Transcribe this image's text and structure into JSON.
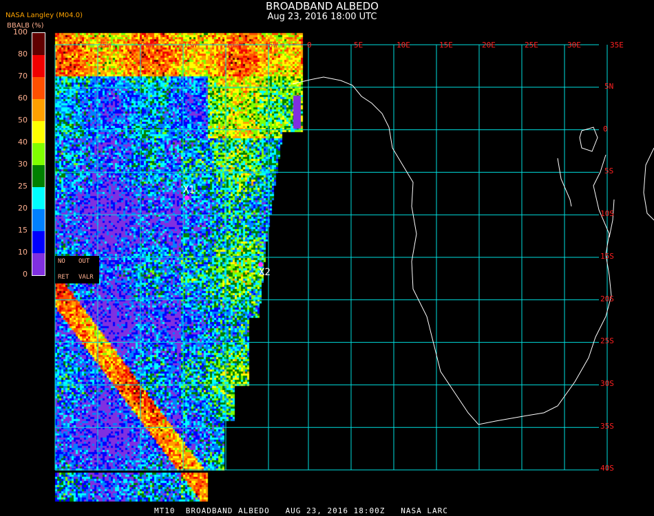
{
  "header": {
    "title": "BROADBAND ALBEDO",
    "subtitle": "Aug 23, 2016 18:00 UTC",
    "org": "NASA Langley (M04.0)"
  },
  "legend": {
    "unit": "BBALB (%)",
    "labels": [
      "100",
      "80",
      "70",
      "60",
      "50",
      "40",
      "30",
      "25",
      "20",
      "15",
      "10",
      "0"
    ],
    "colors": [
      "#600000",
      "#f00000",
      "#ff5000",
      "#ffa000",
      "#ffff00",
      "#80ff00",
      "#008000",
      "#00ffff",
      "#0080ff",
      "#0000ff",
      "#8030e0"
    ],
    "no_retrieval": [
      "NO",
      "OUT",
      "RET",
      "VALR"
    ]
  },
  "grid": {
    "lon_labels": [
      "25W",
      "20W",
      "15W",
      "10W",
      "5W",
      "0",
      "5E",
      "10E",
      "15E",
      "20E",
      "25E",
      "30E",
      "35E"
    ],
    "lat_labels": [
      "5N",
      "0",
      "5S",
      "10S",
      "15S",
      "20S",
      "25S",
      "30S",
      "35S",
      "40S"
    ],
    "grid_color": "#00e0e0",
    "label_color": "#ff2020"
  },
  "markers": [
    {
      "label": "X1"
    },
    {
      "label": "X2"
    }
  ],
  "footer": "MT10  BROADBAND ALBEDO   AUG 23, 2016 18:00Z   NASA LARC"
}
